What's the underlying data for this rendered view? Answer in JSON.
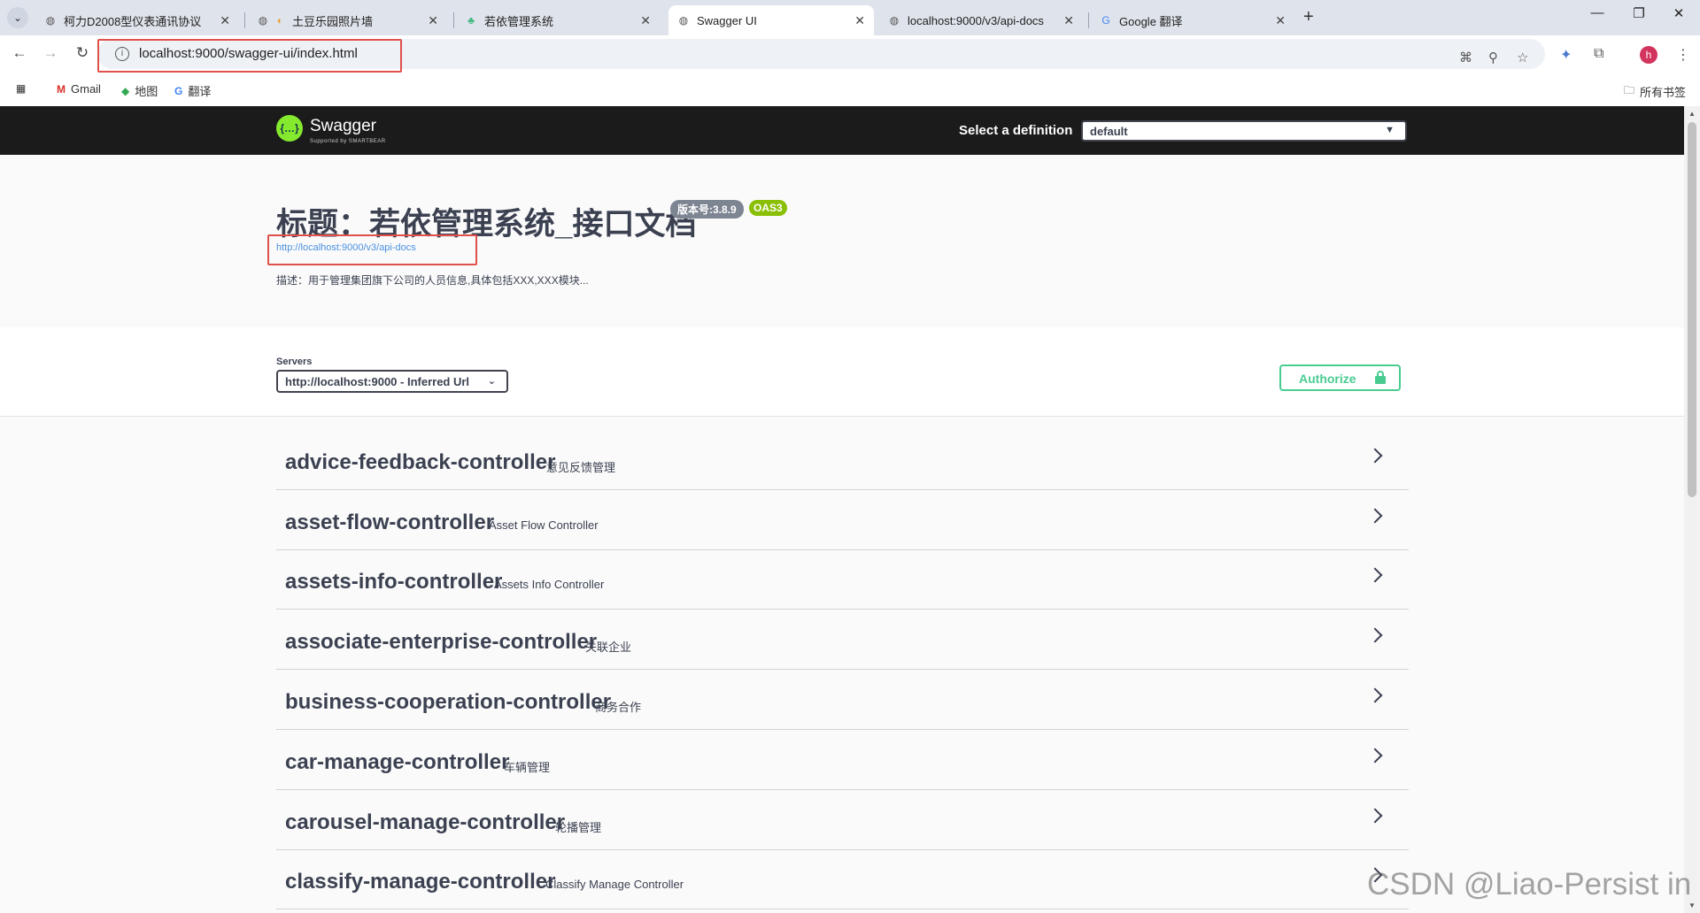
{
  "browser": {
    "tabs": [
      {
        "title": "柯力D2008型仪表通讯协议",
        "icon": "globe-icon",
        "active": false
      },
      {
        "title": "土豆乐园照片墙",
        "icon": "leaf-icon",
        "active": false
      },
      {
        "title": "若依管理系统",
        "icon": "leaf-icon",
        "active": false
      },
      {
        "title": "Swagger UI",
        "icon": "globe-icon",
        "active": true
      },
      {
        "title": "localhost:9000/v3/api-docs",
        "icon": "globe-icon",
        "active": false
      },
      {
        "title": "Google 翻译",
        "icon": "translate-icon",
        "active": false
      }
    ],
    "address": "localhost:9000/swagger-ui/index.html",
    "bookmarks": [
      {
        "label": "Gmail",
        "icon": "gmail-icon"
      },
      {
        "label": "地图",
        "icon": "maps-icon"
      },
      {
        "label": "翻译",
        "icon": "translate-icon"
      }
    ],
    "all_bookmarks": "所有书签",
    "profile_initial": "h"
  },
  "swagger": {
    "logo_text": "Swagger",
    "logo_sub": "Supported by SMARTBEAR",
    "select_label": "Select a definition",
    "definition": "default",
    "title": "标题：若依管理系统_接口文档",
    "version_badge": "版本号:3.8.9",
    "oas_badge": "OAS3",
    "docs_link": "http://localhost:9000/v3/api-docs",
    "description": "描述：用于管理集团旗下公司的人员信息,具体包括XXX,XXX模块...",
    "servers_label": "Servers",
    "server": "http://localhost:9000 - Inferred Url",
    "authorize": "Authorize",
    "controllers": [
      {
        "name": "advice-feedback-controller",
        "desc": "意见反馈管理"
      },
      {
        "name": "asset-flow-controller",
        "desc": "Asset Flow Controller"
      },
      {
        "name": "assets-info-controller",
        "desc": "Assets Info Controller"
      },
      {
        "name": "associate-enterprise-controller",
        "desc": "关联企业"
      },
      {
        "name": "business-cooperation-controller",
        "desc": "商务合作"
      },
      {
        "name": "car-manage-controller",
        "desc": "车辆管理"
      },
      {
        "name": "carousel-manage-controller",
        "desc": "轮播管理"
      },
      {
        "name": "classify-manage-controller",
        "desc": "Classify Manage Controller"
      }
    ]
  },
  "watermark": "CSDN @Liao-Persist in",
  "colors": {
    "topbar": "#1b1b1b",
    "swagger_green": "#85ea2d",
    "authorize_green": "#49cc90",
    "oas_green": "#89bf04",
    "link_blue": "#4990e2",
    "highlight_red": "#e0504a"
  }
}
